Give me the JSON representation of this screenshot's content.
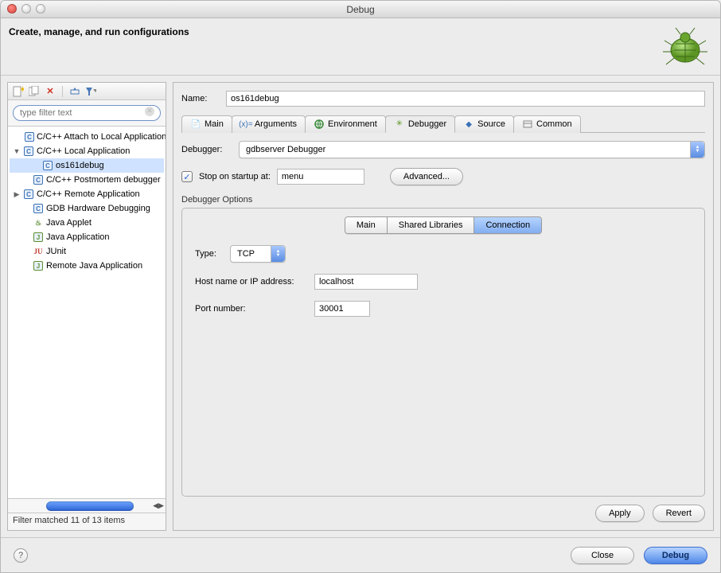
{
  "window": {
    "title": "Debug"
  },
  "header": {
    "title": "Create, manage, and run configurations"
  },
  "filter": {
    "placeholder": "type filter text"
  },
  "tree": {
    "items": [
      {
        "label": "C/C++ Attach to Local Application"
      },
      {
        "label": "C/C++ Local Application"
      },
      {
        "label": "os161debug"
      },
      {
        "label": "C/C++ Postmortem debugger"
      },
      {
        "label": "C/C++ Remote Application"
      },
      {
        "label": "GDB Hardware Debugging"
      },
      {
        "label": "Java Applet"
      },
      {
        "label": "Java Application"
      },
      {
        "label": "JUnit"
      },
      {
        "label": "Remote Java Application"
      }
    ]
  },
  "left_status": "Filter matched 11 of 13 items",
  "form": {
    "name_label": "Name:",
    "name_value": "os161debug",
    "tabs": {
      "main": "Main",
      "arguments": "Arguments",
      "environment": "Environment",
      "debugger": "Debugger",
      "source": "Source",
      "common": "Common"
    },
    "debugger_label": "Debugger:",
    "debugger_value": "gdbserver Debugger",
    "stop_label": "Stop on startup at:",
    "stop_value": "menu",
    "advanced": "Advanced...",
    "options_label": "Debugger Options",
    "subtabs": {
      "main": "Main",
      "shared": "Shared Libraries",
      "connection": "Connection"
    },
    "type_label": "Type:",
    "type_value": "TCP",
    "host_label": "Host name or IP address:",
    "host_value": "localhost",
    "port_label": "Port number:",
    "port_value": "30001",
    "apply": "Apply",
    "revert": "Revert"
  },
  "footer": {
    "close": "Close",
    "debug": "Debug"
  }
}
